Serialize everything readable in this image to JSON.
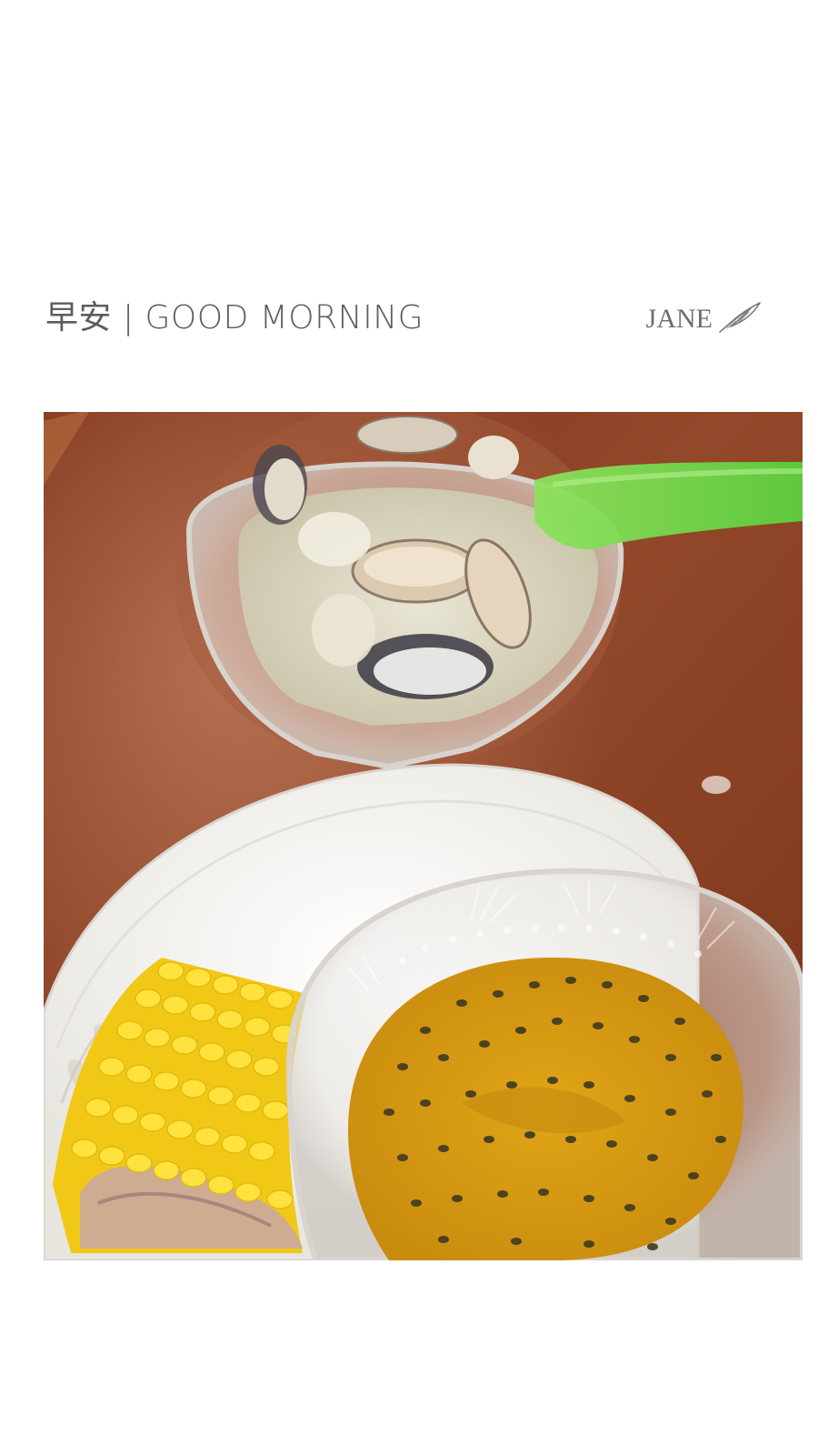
{
  "header": {
    "title": "早安 | GOOD MORNING",
    "signature": "JANE",
    "signature_icon": "feather-icon"
  },
  "photo": {
    "subject": "breakfast-photo"
  },
  "colors": {
    "title_text": "#5d5d5d",
    "signature_text": "#6e6e6e",
    "table_wood": "#8a3f22",
    "plate": "#f4f2ee",
    "corn": "#f7d21c",
    "spoon": "#6fdc4a",
    "passion_fruit": "#d89a14"
  }
}
